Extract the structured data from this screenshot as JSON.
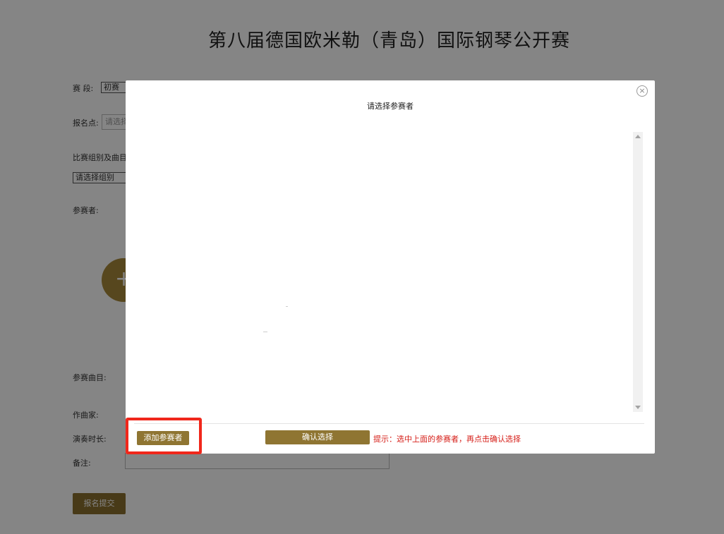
{
  "page": {
    "title": "第八届德国欧米勒（青岛）国际钢琴公开赛"
  },
  "form": {
    "stage_label": "赛  段:",
    "stage_value": "初赛",
    "location_label": "报名点:",
    "location_placeholder": "请选择",
    "group_label": "比赛组别及曲目:",
    "group_select_value": "请选择组别",
    "participants_label": "参赛者:",
    "add_icon": "+",
    "pieces_label": "参赛曲目:",
    "composer_label": "作曲家:",
    "duration_label": "演奏时长:",
    "remark_label": "备注:",
    "submit_label": "报名提交"
  },
  "modal": {
    "title": "请选择参赛者",
    "close_icon": "close-icon",
    "close_glyph": "×",
    "add_participant_label": "添加参赛者",
    "confirm_label": "确认选择",
    "hint": "提示：选中上面的参赛者，再点击确认选择"
  },
  "colors": {
    "brand_gold": "#8f7532",
    "hint_red": "#d6201a",
    "highlight_red": "#f0271b"
  }
}
